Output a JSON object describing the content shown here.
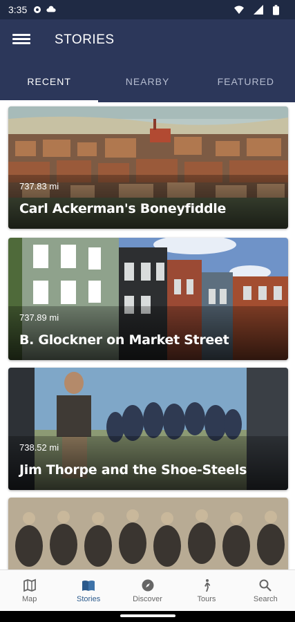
{
  "status_bar": {
    "time": "3:35"
  },
  "app_bar": {
    "title": "STORIES"
  },
  "tabs": [
    {
      "label": "RECENT",
      "active": true
    },
    {
      "label": "NEARBY",
      "active": false
    },
    {
      "label": "FEATURED",
      "active": false
    }
  ],
  "stories": [
    {
      "distance": "737.83 mi",
      "title": "Carl Ackerman's Boneyfiddle"
    },
    {
      "distance": "737.89 mi",
      "title": "B. Glockner on Market Street"
    },
    {
      "distance": "738.52 mi",
      "title": "Jim Thorpe and the Shoe-Steels"
    },
    {
      "distance": "",
      "title": ""
    }
  ],
  "bottom_nav": [
    {
      "label": "Map",
      "icon": "map-icon",
      "active": false
    },
    {
      "label": "Stories",
      "icon": "book-icon",
      "active": true
    },
    {
      "label": "Discover",
      "icon": "compass-icon",
      "active": false
    },
    {
      "label": "Tours",
      "icon": "walking-icon",
      "active": false
    },
    {
      "label": "Search",
      "icon": "search-icon",
      "active": false
    }
  ],
  "colors": {
    "primary": "#2c375a",
    "status_bar": "#1f2a44",
    "nav_active": "#2b5a8c"
  }
}
